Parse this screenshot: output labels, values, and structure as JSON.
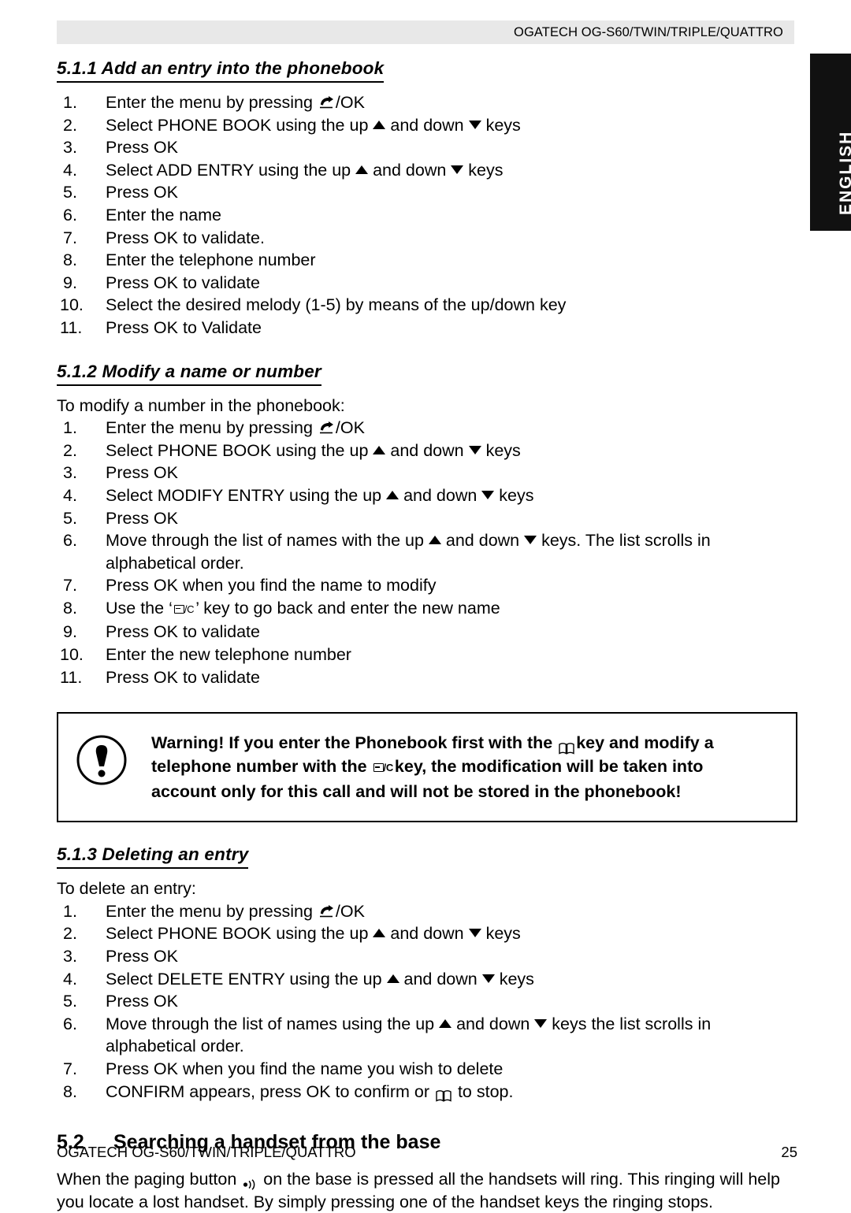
{
  "header": {
    "title": "OGATECH OG-S60/TWIN/TRIPLE/QUATTRO"
  },
  "side_tab": {
    "label": "ENGLISH",
    "background": "#111111",
    "text_color": "#ffffff"
  },
  "sections": [
    {
      "id": "5.1.1",
      "heading": "5.1.1 Add an entry into the phonebook",
      "steps": [
        {
          "num": "1.",
          "pre": "Enter the menu by pressing ",
          "icon": "hook-icon",
          "post": "/OK"
        },
        {
          "num": "2.",
          "pre": "Select PHONE BOOK using the up ",
          "icon": "up-triangle",
          "mid": " and down ",
          "icon2": "down-triangle",
          "post": " keys"
        },
        {
          "num": "3.",
          "pre": "Press OK"
        },
        {
          "num": "4.",
          "pre": "Select ADD ENTRY using the up ",
          "icon": "up-triangle",
          "mid": " and down ",
          "icon2": "down-triangle",
          "post": " keys"
        },
        {
          "num": "5.",
          "pre": "Press OK"
        },
        {
          "num": "6.",
          "pre": "Enter the name"
        },
        {
          "num": "7.",
          "pre": "Press OK to validate."
        },
        {
          "num": "8.",
          "pre": "Enter the telephone number"
        },
        {
          "num": "9.",
          "pre": "Press OK to validate"
        },
        {
          "num": "10.",
          "pre": "Select the desired melody (1-5) by means of the up/down key"
        },
        {
          "num": "11.",
          "pre": "Press OK to Validate"
        }
      ]
    },
    {
      "id": "5.1.2",
      "heading": "5.1.2 Modify a name or number",
      "intro": "To modify a number in the phonebook:",
      "steps": [
        {
          "num": "1.",
          "pre": "Enter the menu by pressing ",
          "icon": "hook-icon",
          "post": "/OK"
        },
        {
          "num": "2.",
          "pre": "Select PHONE BOOK using the up ",
          "icon": "up-triangle",
          "mid": " and down ",
          "icon2": "down-triangle",
          "post": " keys"
        },
        {
          "num": "3.",
          "pre": "Press OK"
        },
        {
          "num": "4.",
          "pre": "Select MODIFY ENTRY using the up ",
          "icon": "up-triangle",
          "mid": " and down ",
          "icon2": "down-triangle",
          "post": " keys"
        },
        {
          "num": "5.",
          "pre": "Press OK"
        },
        {
          "num": "6.",
          "pre": "Move through the list of names with the up ",
          "icon": "up-triangle",
          "mid": " and down ",
          "icon2": "down-triangle",
          "post": " keys. The list scrolls in alphabetical order."
        },
        {
          "num": "7.",
          "pre": "Press OK when you find the name to modify"
        },
        {
          "num": "8.",
          "pre": "Use the ‘",
          "icon": "clear-key-icon",
          "post": "’ key to go back and enter the new name"
        },
        {
          "num": "9.",
          "pre": "Press OK to validate"
        },
        {
          "num": "10.",
          "pre": "Enter the new telephone number"
        },
        {
          "num": "11.",
          "pre": "Press OK to validate"
        }
      ]
    },
    {
      "id": "5.1.3",
      "heading": "5.1.3 Deleting an entry",
      "intro": "To delete an entry:",
      "steps": [
        {
          "num": "1.",
          "pre": "Enter the menu by pressing ",
          "icon": "hook-icon",
          "post": "/OK"
        },
        {
          "num": "2.",
          "pre": "Select PHONE BOOK using the up ",
          "icon": "up-triangle",
          "mid": " and down ",
          "icon2": "down-triangle",
          "post": " keys"
        },
        {
          "num": "3.",
          "pre": "Press OK"
        },
        {
          "num": "4.",
          "pre": "Select DELETE ENTRY using the up ",
          "icon": "up-triangle",
          "mid": " and down ",
          "icon2": "down-triangle",
          "post": " keys"
        },
        {
          "num": "5.",
          "pre": "Press OK"
        },
        {
          "num": "6.",
          "pre": "Move through the list of names using the up ",
          "icon": "up-triangle",
          "mid": " and down ",
          "icon2": "down-triangle",
          "post": " keys the list scrolls in alphabetical order."
        },
        {
          "num": "7.",
          "pre": "Press OK when you find the name you wish to delete"
        },
        {
          "num": "8.",
          "pre": "CONFIRM appears, press OK to confirm or ",
          "icon": "book-icon",
          "post": " to stop."
        }
      ]
    }
  ],
  "warning": {
    "icon": "exclamation-circle-icon",
    "line1_a": "Warning! If you enter the Phonebook first with the ",
    "line1_icon": "book-icon",
    "line1_b": "key and modify a",
    "line2_a": "telephone number with the ",
    "line2_icon": "clear-key-icon",
    "line2_b": "key, the modification will be taken into",
    "line3": "account only for this call and will not be stored in the phonebook!"
  },
  "section_52": {
    "number": "5.2",
    "title": "Searching a handset from the base",
    "body_a": "When the paging button ",
    "body_icon": "paging-speaker-icon",
    "body_b": " on the base is pressed all the handsets will ring. This ringing will help you locate a lost handset. By simply pressing one of the handset keys the ringing stops."
  },
  "footer": {
    "left": "OGATECH OG-S60/TWIN/TRIPLE/QUATTRO",
    "page": "25"
  }
}
